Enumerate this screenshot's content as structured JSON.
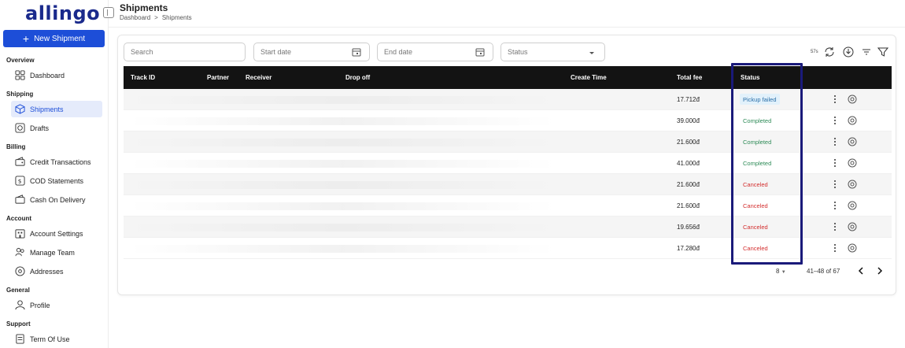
{
  "sidebar": {
    "logo": "allingo",
    "new_button": "New Shipment",
    "groups": {
      "overview": "Overview",
      "shipping": "Shipping",
      "billing": "Billing",
      "account": "Account",
      "general": "General",
      "support": "Support"
    },
    "items": {
      "dashboard": "Dashboard",
      "shipments": "Shipments",
      "drafts": "Drafts",
      "credit": "Credit Transactions",
      "cod": "COD Statements",
      "cash": "Cash On Delivery",
      "settings": "Account Settings",
      "team": "Manage Team",
      "addresses": "Addresses",
      "profile": "Profile",
      "terms": "Term Of Use"
    }
  },
  "header": {
    "title": "Shipments",
    "breadcrumb": [
      "Dashboard",
      ">",
      "Shipments"
    ]
  },
  "filters": {
    "search": "Search",
    "start_date": "Start date",
    "end_date": "End date",
    "status": "Status",
    "count_label": "57s"
  },
  "table": {
    "columns": {
      "track_id": "Track ID",
      "partner": "Partner",
      "receiver": "Receiver",
      "drop_off": "Drop off",
      "create_time": "Create Time",
      "total_fee": "Total fee",
      "status": "Status"
    },
    "rows": [
      {
        "fee": "17.712đ",
        "status": "Pickup failed"
      },
      {
        "fee": "39.000đ",
        "status": "Completed"
      },
      {
        "fee": "21.600đ",
        "status": "Completed"
      },
      {
        "fee": "41.000đ",
        "status": "Completed"
      },
      {
        "fee": "21.600đ",
        "status": "Canceled"
      },
      {
        "fee": "21.600đ",
        "status": "Canceled"
      },
      {
        "fee": "19.656đ",
        "status": "Canceled"
      },
      {
        "fee": "17.280đ",
        "status": "Canceled"
      }
    ]
  },
  "pagination": {
    "page_size": "8",
    "range": "41–48 of 67"
  },
  "colors": {
    "primary": "#1d4ed8",
    "header_bg": "#131313",
    "completed": "#2e8b57",
    "canceled": "#d32f2f",
    "pickup_failed": "#2a6fa8",
    "highlight": "#1a1a7a"
  }
}
